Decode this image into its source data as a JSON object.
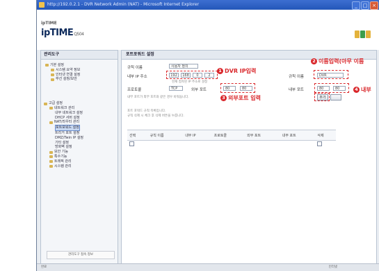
{
  "window": {
    "title": "http://192.0.2.1 - DVR Network Admin (NAT) - Microsoft Internet Explorer",
    "minimize": "_",
    "maximize": "□",
    "close": "×"
  },
  "header": {
    "brand_small": "ipTIME",
    "brand_main": "ipTIME",
    "brand_sub": "Q504",
    "icon_labels": "■ ■ ■"
  },
  "sidebar": {
    "title": "관리도구",
    "items": [
      "기본 설정",
      "시스템 요약 정보",
      "인터넷 연결 설정",
      "무선 설정/보안",
      "고급 설정",
      "네트워크 관리",
      "내부 네트워크 설정",
      "DHCP 서버 설정",
      "NAT/라우터 관리",
      "포트포워드 설정",
      "트리거 포트 설정",
      "DMZ/Twin IP 설정",
      "기타 설정",
      "방화벽 설정",
      "보안 기능",
      "특수기능",
      "트래픽 관리",
      "시스템 관리"
    ],
    "footer": "관리도구 접속 정보"
  },
  "main": {
    "title": "포트포워드 설정",
    "fields": {
      "rule_label": "규칙 이름",
      "rule_select": "사용자 정의",
      "internal_ip_label": "내부 IP 주소",
      "ip_parts": [
        "192",
        "168",
        "0",
        "2"
      ],
      "current_ip_note": "현재 접속된 IP 주소로 설정",
      "protocol_label": "프로토콜",
      "protocol_value": "TCP",
      "ext_port_label": "외부 포트",
      "ext_port_from": "80",
      "ext_port_to": "80",
      "int_port_label": "내부 포트",
      "int_port_from": "80",
      "int_port_to": "80",
      "name_label": "규칙 이름",
      "name_value": "DVR",
      "hint": "내부 포트가 외부 포트와 같은 경우 비워둡니다.",
      "add_button": "추가",
      "note1": "포트 포워드 규칙 목록입니다.",
      "note2": "규칙 삭제 시 체크 후 삭제 버튼을 누릅니다."
    },
    "callouts": {
      "c1_num": "1",
      "c1_text": "DVR IP입력",
      "c2_num": "2",
      "c2_text": "이름입력(아무 이름",
      "c3_num": "3",
      "c3_text": "외부포트 입력",
      "c4_num": "4",
      "c4_text": "내부"
    },
    "table": {
      "headers": [
        "선택",
        "규칙 이름",
        "내부 IP",
        "프로토콜",
        "외부 포트",
        "내부 포트",
        "삭제"
      ],
      "empty": ""
    }
  },
  "status": {
    "left": "완료",
    "right": "인터넷"
  },
  "colors": {
    "accent": "#d9262a",
    "titlebar": "#2457b9"
  }
}
